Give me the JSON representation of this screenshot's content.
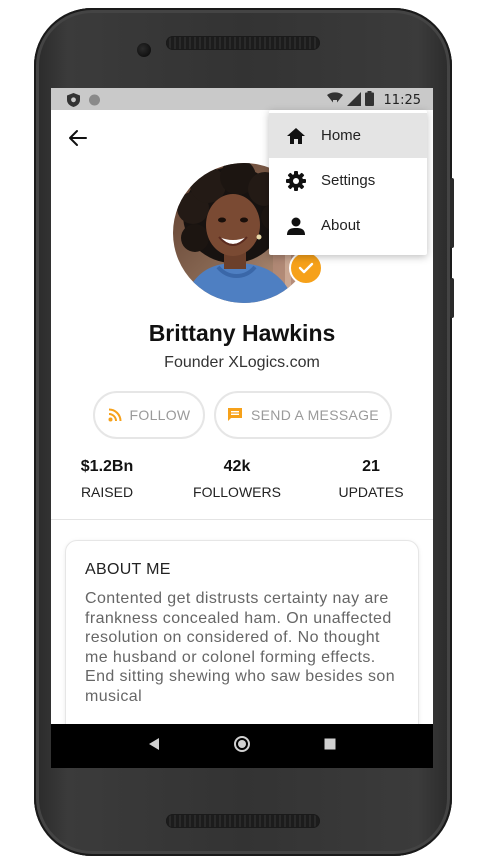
{
  "status_bar": {
    "time": "11:25"
  },
  "profile": {
    "name": "Brittany Hawkins",
    "subtitle": "Founder XLogics.com"
  },
  "actions": {
    "follow_label": "FOLLOW",
    "message_label": "SEND A MESSAGE"
  },
  "stats": [
    {
      "value": "$1.2Bn",
      "label": "RAISED"
    },
    {
      "value": "42k",
      "label": "FOLLOWERS"
    },
    {
      "value": "21",
      "label": "UPDATES"
    }
  ],
  "about": {
    "title": "ABOUT ME",
    "body": "Contented get distrusts certainty nay are frankness concealed ham. On unaffected resolution on considered of. No thought me husband or colonel forming effects. End sitting shewing who saw besides son musical"
  },
  "menu": {
    "items": [
      {
        "label": "Home",
        "icon": "home-icon",
        "active": true
      },
      {
        "label": "Settings",
        "icon": "gear-icon",
        "active": false
      },
      {
        "label": "About",
        "icon": "person-icon",
        "active": false
      }
    ]
  },
  "colors": {
    "accent": "#f6a11a",
    "statusbar": "#c9c9c9",
    "menu_active": "#e4e4e4"
  }
}
